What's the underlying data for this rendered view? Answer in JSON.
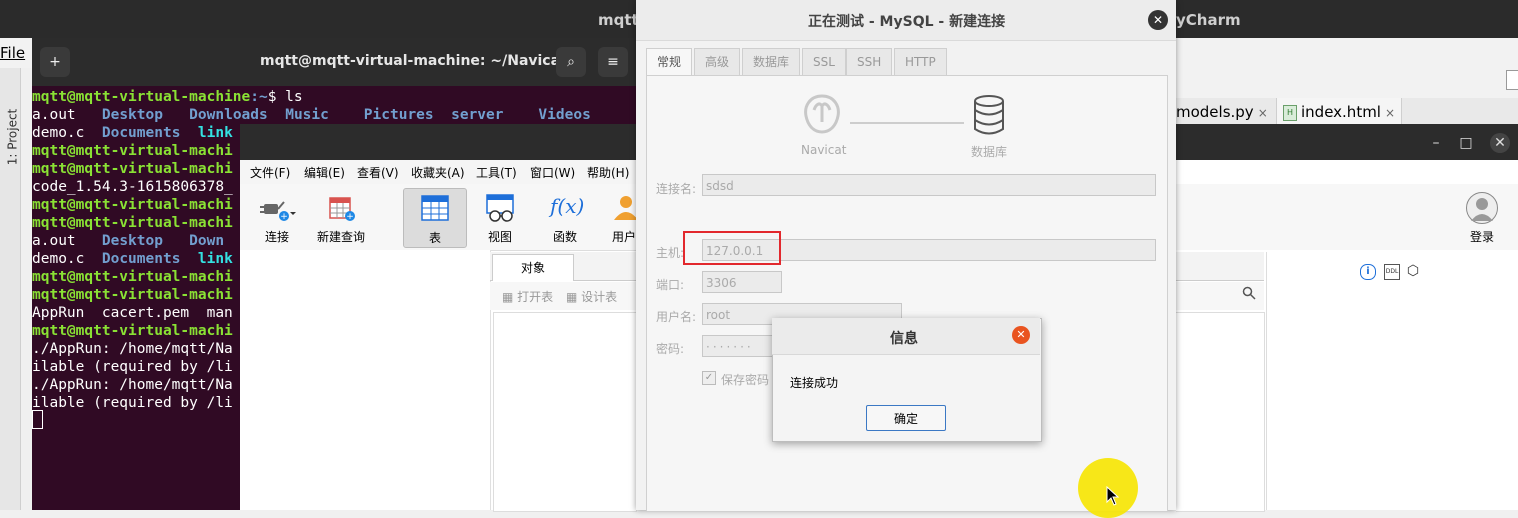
{
  "pycharm": {
    "title_left": "mqtt_",
    "title_right": "yCharm",
    "menu_file": "File",
    "project_label": "1: Project",
    "tabs": [
      {
        "label": "models.py"
      },
      {
        "label": "index.html",
        "icon_text": "H"
      }
    ],
    "tab_close": "×"
  },
  "terminal": {
    "title": "mqtt@mqtt-virtual-machine: ~/Navicat",
    "newtab_icon": "+",
    "search_icon": "⌕",
    "menu_icon": "≡",
    "lines": [
      {
        "prompt_user": "mqtt@mqtt-virtual-machine",
        "prompt_path": ":~",
        "cmd": "$ ls"
      },
      {
        "text": "a.out   Desktop   Downloads  Music    Pictures  server    Videos"
      },
      {
        "text": "demo.c  Documents  link"
      },
      {
        "text": "mqtt@mqtt-virtual-machi"
      },
      {
        "text": "mqtt@mqtt-virtual-machi"
      },
      {
        "text": "code_1.54.3-1615806378_"
      },
      {
        "text": "mqtt@mqtt-virtual-machi"
      },
      {
        "text": "mqtt@mqtt-virtual-machi"
      },
      {
        "text": "a.out   Desktop   Down"
      },
      {
        "text": "demo.c  Documents  link"
      },
      {
        "text": "mqtt@mqtt-virtual-machi"
      },
      {
        "text": "mqtt@mqtt-virtual-machi"
      },
      {
        "text": "AppRun  cacert.pem  man"
      },
      {
        "text": "mqtt@mqtt-virtual-machi"
      },
      {
        "text": "./AppRun: /home/mqtt/Na"
      },
      {
        "text": "ilable (required by /li"
      },
      {
        "text": "./AppRun: /home/mqtt/Na"
      },
      {
        "text": "ilable (required by /li"
      }
    ]
  },
  "navicat": {
    "menu": [
      "文件(F)",
      "编辑(E)",
      "查看(V)",
      "收藏夹(A)",
      "工具(T)",
      "窗口(W)",
      "帮助(H)"
    ],
    "toolbar": {
      "connect": "连接",
      "new_query": "新建查询",
      "table": "表",
      "view": "视图",
      "function": "函数",
      "user": "用户",
      "login": "登录",
      "function_icon": "f(x)"
    },
    "objects_tab": "对象",
    "open_table": "打开表",
    "design_table": "设计表",
    "window_controls": {
      "min": "–",
      "max": "□",
      "close": "✕"
    },
    "info_ddl_icon": "DDL"
  },
  "connection_dialog": {
    "title": "正在测试 - MySQL - 新建连接",
    "close": "✕",
    "tabs": [
      "常规",
      "高级",
      "数据库",
      "SSL",
      "SSH",
      "HTTP"
    ],
    "navicat_label": "Navicat",
    "db_label": "数据库",
    "fields": {
      "name_label": "连接名:",
      "name_value": "sdsd",
      "host_label": "主机:",
      "host_value": "127.0.0.1",
      "port_label": "端口:",
      "port_value": "3306",
      "user_label": "用户名:",
      "user_value": "root",
      "pass_label": "密码:",
      "pass_value": "·······"
    },
    "save_password": "保存密码",
    "checkmark": "✓"
  },
  "message_dialog": {
    "title": "信息",
    "close": "✕",
    "text": "连接成功",
    "ok": "确定"
  },
  "colors": {
    "terminal_bg": "#300a24",
    "highlight_red": "#e2282d",
    "close_orange": "#e95420",
    "cursor_halo": "#f7e600"
  }
}
